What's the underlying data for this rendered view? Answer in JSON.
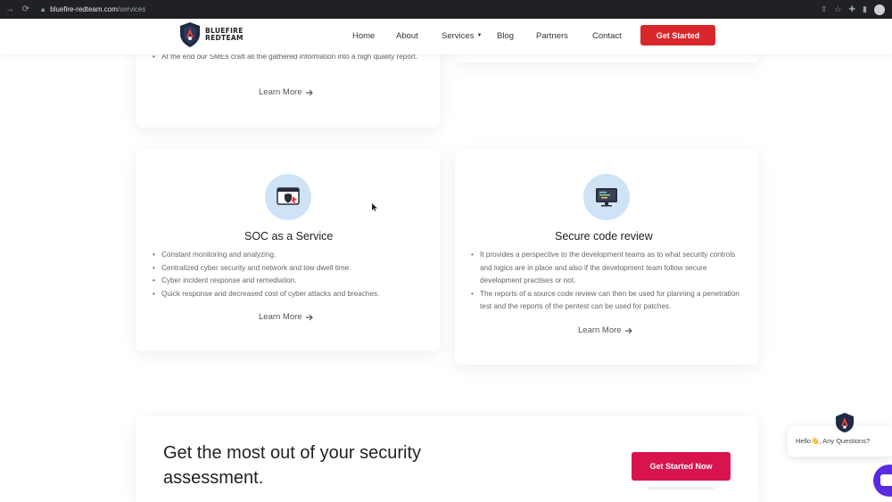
{
  "browser": {
    "url_domain": "bluefire-redteam.com",
    "url_path": "/services"
  },
  "header": {
    "logo_line1": "BLUEFIRE",
    "logo_line2": "REDTEAM",
    "nav": {
      "home": "Home",
      "about": "About",
      "services": "Services",
      "blog": "Blog",
      "partners": "Partners",
      "contact": "Contact"
    },
    "cta_label": "Get Started"
  },
  "top_card": {
    "bullet": "At the end our SMEs craft all the gathered information into a high quality report.",
    "learn_more": "Learn More"
  },
  "soc_card": {
    "icon": "browser-shield-icon",
    "title": "SOC as a Service",
    "bullets": [
      "Constant monitoring and analyzing.",
      "Centralized cyber security and network and low dwell time.",
      "Cyber incident response and remediation.",
      "Quick response and decreased cost of cyber attacks and breaches."
    ],
    "learn_more": "Learn More"
  },
  "code_card": {
    "icon": "code-monitor-icon",
    "title": "Secure code review",
    "bullets": [
      "It provides a perspective to the development teams as to what security controls and logics are in place and also if the development team follow secure development practises or not.",
      "The reports of a source code review can then be used for planning a penetration test and the reports of the pentest can be used for patches."
    ],
    "learn_more": "Learn More"
  },
  "cta": {
    "title": "Get the most out of your security assessment.",
    "button": "Get Started Now"
  },
  "chat": {
    "greeting": "Hello👋, Any Questions?"
  },
  "colors": {
    "header_button": "#d9262b",
    "cta_button": "#d8144f",
    "icon_circle": "#cfe3f6",
    "chat_launcher": "#5a2ae0"
  }
}
